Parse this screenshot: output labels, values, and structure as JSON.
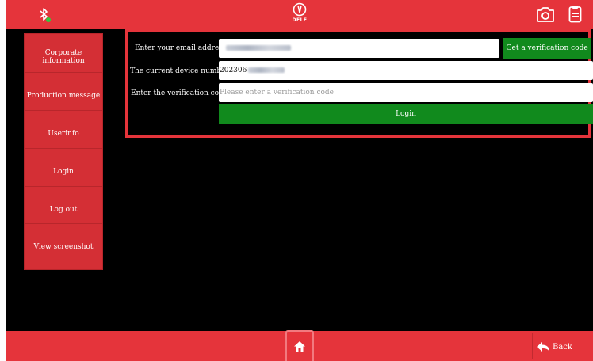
{
  "topbar": {
    "brand_text": "DFLE",
    "icons": [
      "bluetooth-icon",
      "camera-icon",
      "document-icon"
    ]
  },
  "sidebar": {
    "items": [
      {
        "label": "Corporate information"
      },
      {
        "label": "Production message"
      },
      {
        "label": "Userinfo"
      },
      {
        "label": "Login"
      },
      {
        "label": "Log out"
      },
      {
        "label": "View screenshot"
      }
    ]
  },
  "login_form": {
    "email_label": "Enter your email address",
    "device_label": "The current device number",
    "device_value_prefix": "202306",
    "code_label": "Enter the verification code",
    "code_placeholder": "Please enter a verification code",
    "get_code_button": "Get a verification code",
    "login_button": "Login"
  },
  "bottombar": {
    "back_label": "Back"
  },
  "colors": {
    "header_red": "#e5343b",
    "sidebar_red": "#d42f35",
    "action_green": "#118a1d",
    "background": "#000000"
  }
}
